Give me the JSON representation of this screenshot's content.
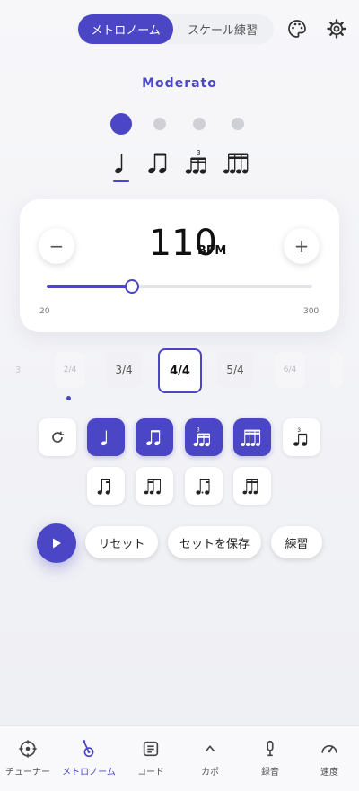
{
  "header": {
    "tabs": [
      {
        "label": "メトロノーム",
        "active": true
      },
      {
        "label": "スケール練習",
        "active": false
      }
    ],
    "icons": [
      "palette-icon",
      "gear-icon"
    ]
  },
  "tempo_marking": "Moderato",
  "beat_indicator": {
    "count": 4,
    "active_index": 0
  },
  "subdivisions": [
    "quarter-note-icon",
    "eighth-notes-icon",
    "triplet-icon",
    "sixteenth-notes-icon"
  ],
  "bpm": {
    "value": "110",
    "unit": "BPM",
    "min": "20",
    "max": "300",
    "minus": "−",
    "plus": "+",
    "current": 110
  },
  "time_signatures": {
    "items": [
      "3",
      "2/4",
      "3/4",
      "4/4",
      "5/4",
      "6/4"
    ],
    "selected": "4/4"
  },
  "rhythm_patterns": {
    "row1": [
      "loop-icon",
      "quarter-note-icon",
      "eighth-notes-icon",
      "triplet-icon",
      "sixteenth-notes-icon",
      "triplet-eighths-icon"
    ],
    "row2": [
      "eighth-sixteenths-icon",
      "sixteenths-eighth-icon",
      "dotted-eighth-sixteenth-icon",
      "sixteenth-dotted-eighth-icon"
    ],
    "active": [
      1,
      2,
      3,
      4
    ]
  },
  "actions": {
    "play": "play-icon",
    "reset": "リセット",
    "save": "セットを保存",
    "practice": "練習"
  },
  "nav": [
    {
      "label": "チューナー",
      "icon": "tuner-icon"
    },
    {
      "label": "メトロノーム",
      "icon": "metronome-icon",
      "active": true
    },
    {
      "label": "コード",
      "icon": "chord-icon"
    },
    {
      "label": "カポ",
      "icon": "capo-icon"
    },
    {
      "label": "録音",
      "icon": "microphone-icon"
    },
    {
      "label": "速度",
      "icon": "speed-icon"
    }
  ],
  "colors": {
    "accent": "#4a46c6",
    "inactive_dot": "#cfcfd6",
    "background": "#f3f3f7"
  }
}
